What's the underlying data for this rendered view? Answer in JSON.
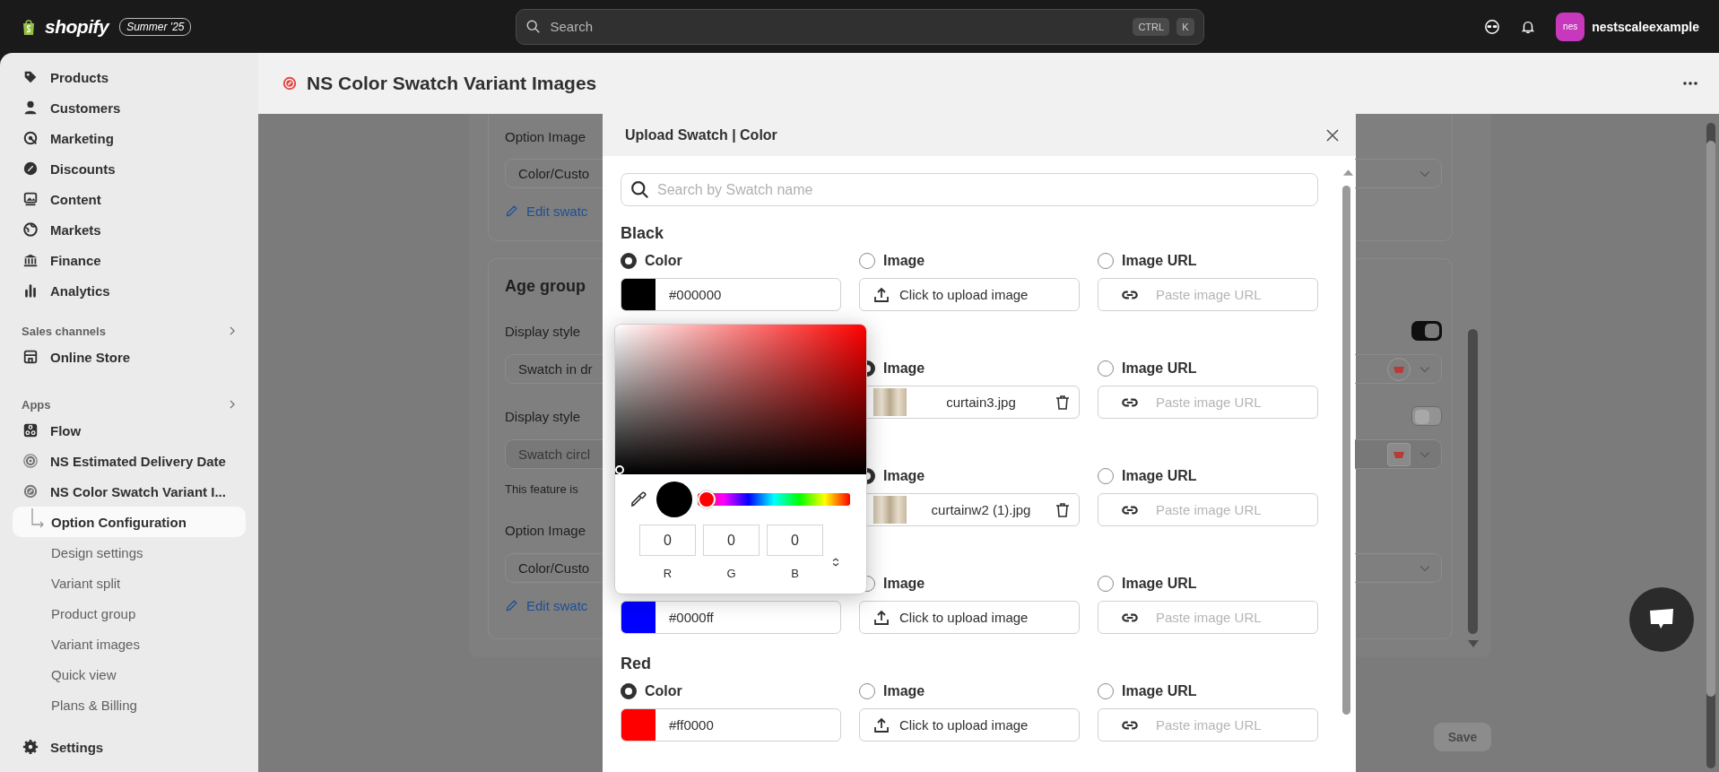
{
  "top_bar": {
    "logo": "shopify",
    "badge": "Summer '25",
    "search": {
      "placeholder": "Search",
      "shortcut": [
        "CTRL",
        "K"
      ]
    },
    "account": {
      "initials": "nes",
      "name": "nestscaleexample"
    }
  },
  "sidebar": {
    "items": [
      {
        "label": "Products"
      },
      {
        "label": "Customers"
      },
      {
        "label": "Marketing"
      },
      {
        "label": "Discounts"
      },
      {
        "label": "Content"
      },
      {
        "label": "Markets"
      },
      {
        "label": "Finance"
      },
      {
        "label": "Analytics"
      }
    ],
    "sections": [
      {
        "title": "Sales channels",
        "items": [
          {
            "label": "Online Store"
          }
        ]
      },
      {
        "title": "Apps",
        "items": [
          {
            "label": "Flow"
          },
          {
            "label": "NS Estimated Delivery Date"
          },
          {
            "label": "NS Color Swatch Variant I...",
            "children": [
              {
                "label": "Option Configuration",
                "selected": true
              },
              {
                "label": "Design settings",
                "selected": false
              },
              {
                "label": "Variant split",
                "selected": false
              },
              {
                "label": "Product group",
                "selected": false
              },
              {
                "label": "Variant images",
                "selected": false
              },
              {
                "label": "Quick view",
                "selected": false
              },
              {
                "label": "Plans & Billing",
                "selected": false
              }
            ]
          }
        ]
      }
    ],
    "footer": {
      "label": "Settings"
    }
  },
  "page": {
    "title": "NS Color Swatch Variant Images"
  },
  "background_cards": [
    {
      "items": [
        {
          "kind": "label",
          "text": "Option Image"
        },
        {
          "kind": "field",
          "value": "Color/Custo",
          "disabled": false
        },
        {
          "kind": "link",
          "text": "Edit swatc"
        }
      ]
    },
    {
      "title": "Age group",
      "items": [
        {
          "kind": "label",
          "text": "Display style",
          "toggle": true
        },
        {
          "kind": "field",
          "value": "Swatch in dr",
          "disabled": false,
          "swatch": {
            "kind": "circle"
          }
        },
        {
          "kind": "label",
          "text": "Display style",
          "toggle": false
        },
        {
          "kind": "field",
          "value": "Swatch circl",
          "disabled": true,
          "swatch": {
            "kind": "square"
          }
        },
        {
          "kind": "note",
          "text": "This feature is"
        },
        {
          "kind": "label",
          "text": "Option Image"
        },
        {
          "kind": "field",
          "value": "Color/Custo",
          "disabled": false
        },
        {
          "kind": "link",
          "text": "Edit swatc"
        }
      ]
    }
  ],
  "save_button": "Save",
  "modal": {
    "title": "Upload Swatch | Color",
    "search_placeholder": "Search by Swatch name",
    "swatches": [
      {
        "name": "Black",
        "options": [
          {
            "kind": "color",
            "label": "Color",
            "selected": true,
            "color": "#000000",
            "hex": "#000000"
          },
          {
            "kind": "upload",
            "label": "Image",
            "selected": false,
            "text": "Click to upload image"
          },
          {
            "kind": "url",
            "label": "Image URL",
            "selected": false,
            "placeholder": "Paste image URL"
          }
        ]
      },
      {
        "options": [
          {
            "kind": "covered"
          },
          {
            "kind": "file",
            "label": "Image",
            "selected": true,
            "file": "curtain3.jpg"
          },
          {
            "kind": "url",
            "label": "Image URL",
            "selected": false,
            "placeholder": "Paste image URL"
          }
        ]
      },
      {
        "options": [
          {
            "kind": "covered"
          },
          {
            "kind": "file",
            "label": "Image",
            "selected": true,
            "file": "curtainw2 (1).jpg"
          },
          {
            "kind": "url",
            "label": "Image URL",
            "selected": false,
            "placeholder": "Paste image URL"
          }
        ]
      },
      {
        "options": [
          {
            "kind": "color",
            "color": "#0000ff",
            "hex": "#0000ff"
          },
          {
            "kind": "upload",
            "label": "Image",
            "selected": false,
            "text": "Click to upload image"
          },
          {
            "kind": "url",
            "label": "Image URL",
            "selected": false,
            "placeholder": "Paste image URL"
          }
        ]
      },
      {
        "name": "Red",
        "options": [
          {
            "kind": "color",
            "label": "Color",
            "selected": true,
            "color": "#ff0000",
            "hex": "#ff0000"
          },
          {
            "kind": "upload",
            "label": "Image",
            "selected": false,
            "text": "Click to upload image"
          },
          {
            "kind": "url",
            "label": "Image URL",
            "selected": false,
            "placeholder": "Paste image URL"
          }
        ]
      }
    ],
    "color_picker": {
      "color": "#000000",
      "hue": {
        "level": 0
      },
      "channels": [
        {
          "label": "R",
          "value": "0"
        },
        {
          "label": "G",
          "value": "0"
        },
        {
          "label": "B",
          "value": "0"
        }
      ]
    }
  }
}
